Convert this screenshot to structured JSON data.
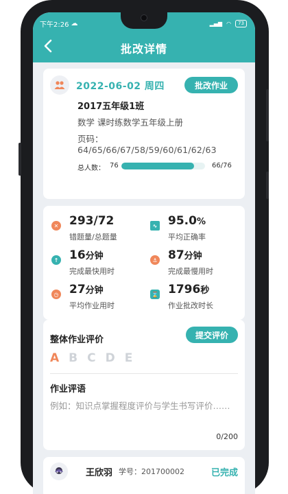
{
  "status_bar": {
    "time": "下午2:26",
    "battery": "73",
    "signal": "HD"
  },
  "header": {
    "title": "批改详情"
  },
  "assignment": {
    "date": "2022-06-02 周四",
    "grade_button": "批改作业",
    "class_name": "2017五年级1班",
    "subject": "数学 课时练数学五年级上册",
    "pages_label": "页码：",
    "pages_value": "64/65/66/67/58/59/60/61/62/63",
    "total_label": "总人数：",
    "total_count": "76",
    "progress_text": "66/76",
    "progress_fraction": 0.868
  },
  "stats": [
    {
      "value": "293/72",
      "unit": "",
      "label": "错题量/总题量",
      "icon": "close-circle-icon",
      "color": "#f0875a"
    },
    {
      "value": "95.0",
      "unit": "%",
      "label": "平均正确率",
      "icon": "trend-chart-icon",
      "color": "#36b2b0"
    },
    {
      "value": "16",
      "unit": "分钟",
      "label": "完成最快用时",
      "icon": "rocket-icon",
      "color": "#36b2b0"
    },
    {
      "value": "87",
      "unit": "分钟",
      "label": "完成最慢用时",
      "icon": "anchor-icon",
      "color": "#f0875a"
    },
    {
      "value": "27",
      "unit": "分钟",
      "label": "平均作业用时",
      "icon": "clock-icon",
      "color": "#f0875a"
    },
    {
      "value": "1796",
      "unit": "秒",
      "label": "作业批改时长",
      "icon": "hourglass-icon",
      "color": "#36b2b0"
    }
  ],
  "evaluation": {
    "title": "整体作业评价",
    "submit_button": "提交评价",
    "grades": [
      "A",
      "B",
      "C",
      "D",
      "E"
    ],
    "selected_grade": "A",
    "comment_title": "作业评语",
    "comment_placeholder": "例如：知识点掌握程度评价与学生书写评价……",
    "counter": "0/200"
  },
  "student": {
    "name": "王欣羽",
    "id_label": "学号：201700002",
    "status": "已完成"
  }
}
